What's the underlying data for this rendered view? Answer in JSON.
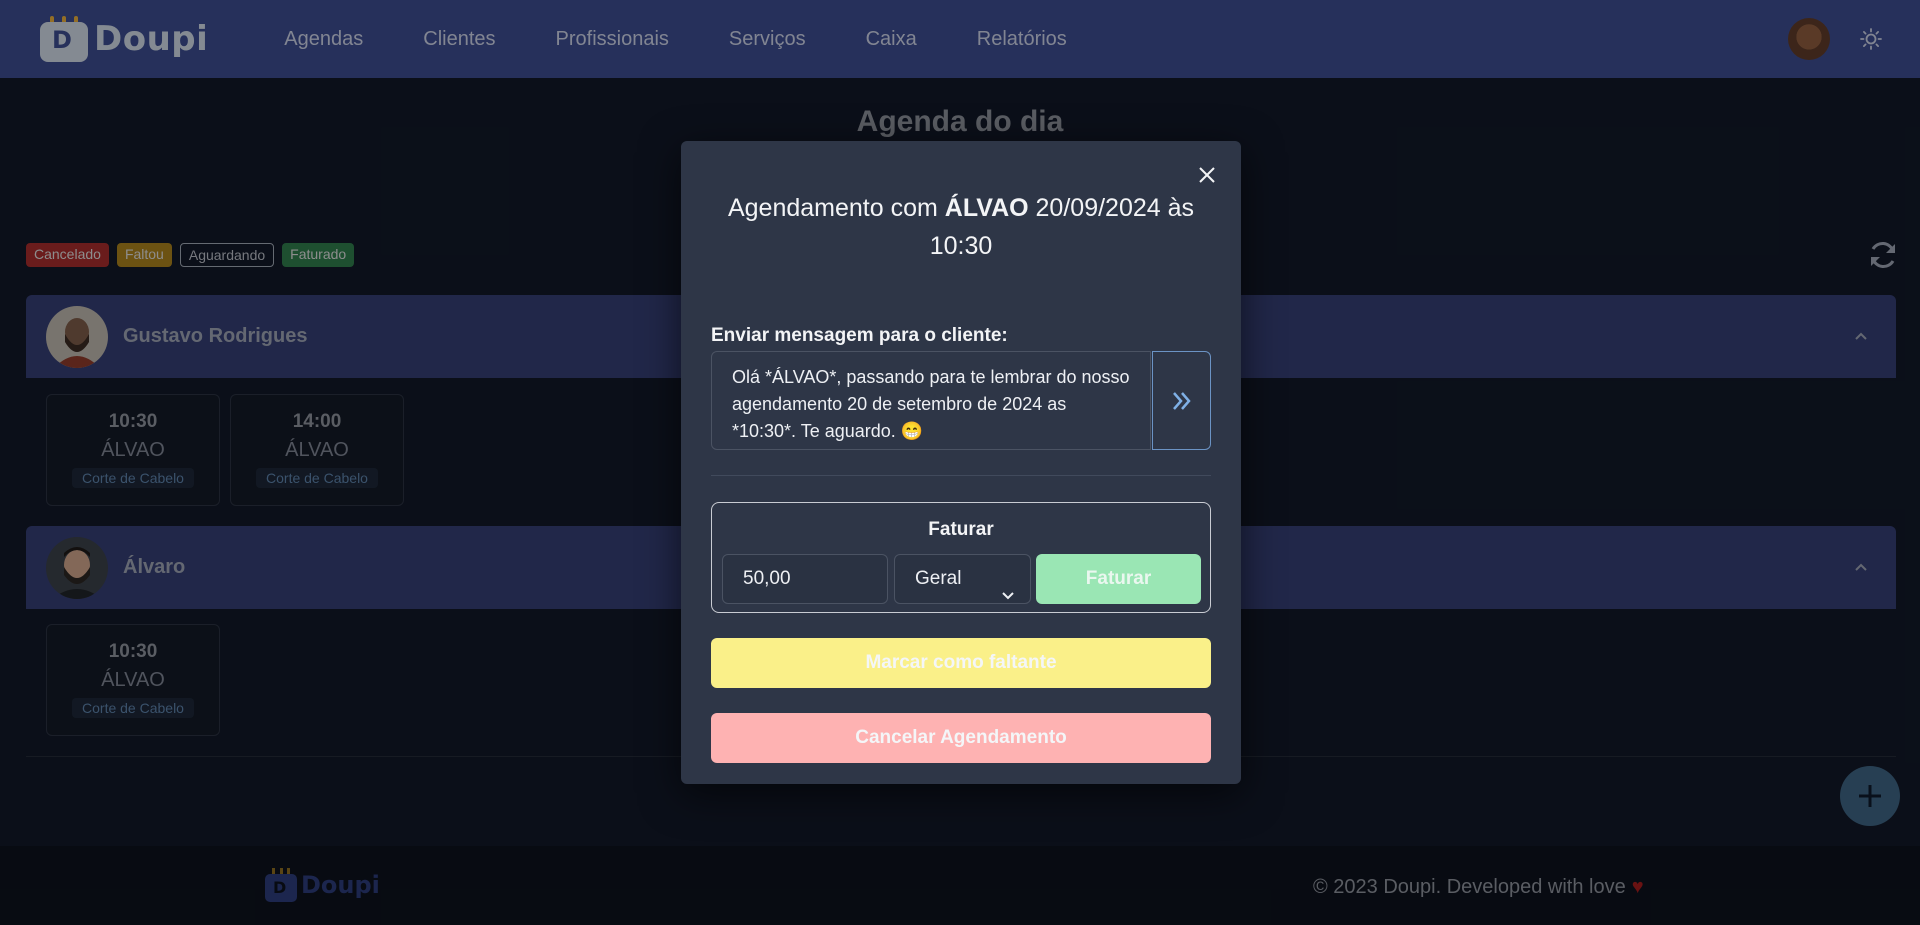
{
  "navbar": {
    "logo_text": "Doupi",
    "links": [
      "Agendas",
      "Clientes",
      "Profissionais",
      "Serviços",
      "Caixa",
      "Relatórios"
    ],
    "avatar_icon": "user-avatar",
    "theme_icon": "sun-icon"
  },
  "page": {
    "title": "Agenda do dia",
    "legend": [
      "Cancelado",
      "Faltou",
      "Aguardando",
      "Faturado"
    ]
  },
  "professionals": [
    {
      "name": "Gustavo Rodrigues",
      "slots": [
        {
          "time": "10:30",
          "client": "ÁLVAO",
          "service": "Corte de Cabelo"
        },
        {
          "time": "14:00",
          "client": "ÁLVAO",
          "service": "Corte de Cabelo"
        }
      ]
    },
    {
      "name": "Álvaro",
      "slots": [
        {
          "time": "10:30",
          "client": "ÁLVAO",
          "service": "Corte de Cabelo"
        }
      ]
    }
  ],
  "footer": {
    "logo_text": "Doupi",
    "copyright": "© 2023 Doupi. Developed with love",
    "heart": "♥"
  },
  "modal": {
    "title_prefix": "Agendamento com",
    "title_client": "ÁLVAO",
    "title_suffix": "20/09/2024 às 10:30",
    "message_label": "Enviar mensagem para o cliente:",
    "message_text": "Olá *ÁLVAO*, passando para te lembrar do nosso agendamento 20 de setembro de 2024 as *10:30*. Te aguardo. 😁",
    "invoice": {
      "title": "Faturar",
      "amount": "50,00",
      "payment_type": "Geral",
      "button": "Faturar"
    },
    "mark_missing_button": "Marcar como faltante",
    "cancel_button": "Cancelar Agendamento"
  },
  "colors": {
    "navbar": "#3b4a8c",
    "background": "#111827",
    "modal": "#2e3647",
    "invoice_button": "#9ae6b4",
    "missing_button": "#faf089",
    "cancel_button": "#feb2b2"
  }
}
